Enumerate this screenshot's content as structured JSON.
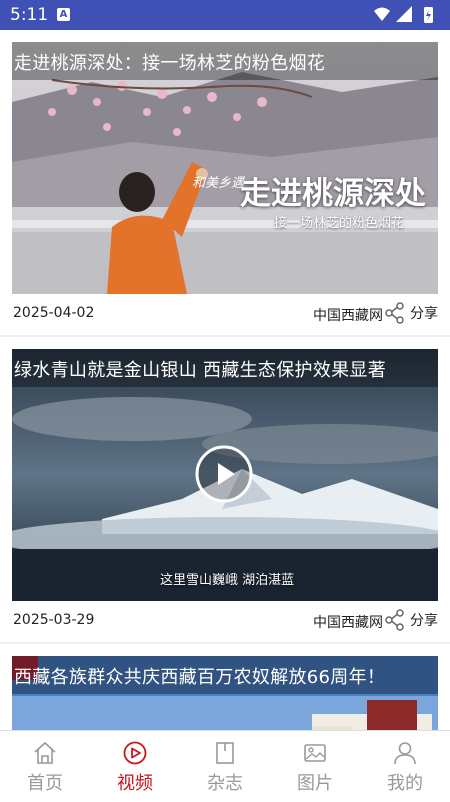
{
  "status_bar": {
    "time": "5:11",
    "app_badge": "A"
  },
  "feed": [
    {
      "title": "走进桃源深处：接一场林芝的粉色烟花",
      "date": "2025-04-02",
      "source": "中国西藏网",
      "share_label": "分享",
      "overlay_small": "和美乡遇",
      "overlay_big": "走进桃源深处",
      "overlay_sub": "接一场林芝的粉色烟花"
    },
    {
      "title": "绿水青山就是金山银山 西藏生态保护效果显著",
      "date": "2025-03-29",
      "source": "中国西藏网",
      "share_label": "分享",
      "caption": "这里雪山巍峨 湖泊湛蓝"
    },
    {
      "title": "西藏各族群众共庆西藏百万农奴解放66周年！"
    }
  ],
  "bottom_nav": [
    {
      "label": "首页",
      "icon": "home-icon",
      "active": false
    },
    {
      "label": "视频",
      "icon": "video-play-icon",
      "active": true
    },
    {
      "label": "杂志",
      "icon": "magazine-icon",
      "active": false
    },
    {
      "label": "图片",
      "icon": "image-icon",
      "active": false
    },
    {
      "label": "我的",
      "icon": "user-icon",
      "active": false
    }
  ],
  "colors": {
    "status_bar": "#3f51b5",
    "accent": "#c8161e",
    "inactive": "#999999"
  }
}
